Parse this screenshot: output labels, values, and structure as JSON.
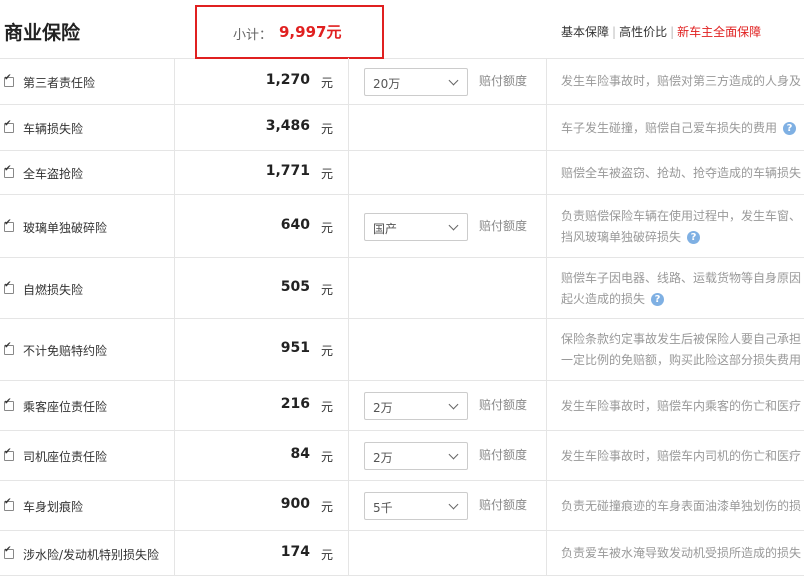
{
  "header": {
    "title": "商业保险",
    "subtotal_label": "小计：",
    "subtotal_value": "9,997元",
    "links": [
      "基本保障",
      "高性价比",
      "新车主全面保障"
    ]
  },
  "coverage_label": "赔付额度",
  "help_glyph": "?",
  "rows": [
    {
      "name": "第三者责任险",
      "amount": "1,270",
      "unit": "元",
      "option": "20万",
      "desc": "发生车险事故时，赔偿对第三方造成的人身及财产损失"
    },
    {
      "name": "车辆损失险",
      "amount": "3,486",
      "unit": "元",
      "option": "",
      "desc": "车子发生碰撞，赔偿自己爱车损失的费用"
    },
    {
      "name": "全车盗抢险",
      "amount": "1,771",
      "unit": "元",
      "option": "",
      "desc": "赔偿全车被盗窃、抢劫、抢夺造成的车辆损失"
    },
    {
      "name": "玻璃单独破碎险",
      "amount": "640",
      "unit": "元",
      "option": "国产",
      "desc": "负责赔偿保险车辆在使用过程中，发生车窗、挡风玻璃单独破碎损失"
    },
    {
      "name": "自燃损失险",
      "amount": "505",
      "unit": "元",
      "option": "",
      "desc": "赔偿车子因电器、线路、运载货物等自身原因起火造成的损失"
    },
    {
      "name": "不计免赔特约险",
      "amount": "951",
      "unit": "元",
      "option": "",
      "desc": "保险条款约定事故发生后被保险人要自己承担一定比例的免赔额，购买此险这部分损失费用保险公司将同样赔偿"
    },
    {
      "name": "乘客座位责任险",
      "amount": "216",
      "unit": "元",
      "option": "2万",
      "desc": "发生车险事故时，赔偿车内乘客的伤亡和医疗费用"
    },
    {
      "name": "司机座位责任险",
      "amount": "84",
      "unit": "元",
      "option": "2万",
      "desc": "发生车险事故时，赔偿车内司机的伤亡和医疗费用"
    },
    {
      "name": "车身划痕险",
      "amount": "900",
      "unit": "元",
      "option": "5千",
      "desc": "负责无碰撞痕迹的车身表面油漆单独划伤的损失"
    },
    {
      "name": "涉水险/发动机特别损失险",
      "amount": "174",
      "unit": "元",
      "option": "",
      "desc": "负责爱车被水淹导致发动机受损所造成的损失"
    }
  ]
}
